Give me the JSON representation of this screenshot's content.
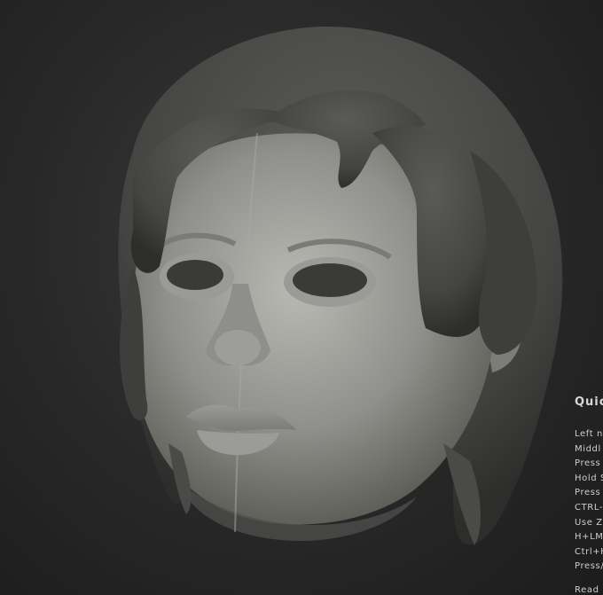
{
  "app": {
    "viewport_background": "#262626",
    "model_color": "#8a8b86",
    "hair_color": "#4a4b48"
  },
  "quick_info": {
    "title": "Quicl",
    "lines": [
      "Left n",
      "Middl",
      "Press",
      "Hold S",
      "Press",
      "CTRL-",
      "Use Z",
      "H+LMB",
      "Ctrl+H",
      "Press/",
      "Read"
    ]
  }
}
